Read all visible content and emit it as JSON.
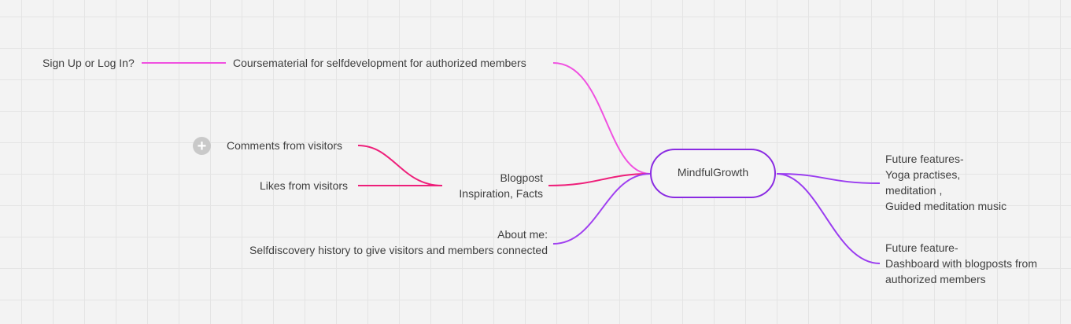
{
  "mindmap": {
    "central": "MindfulGrowth",
    "left_nodes": {
      "coursematerial": "Coursematerial for selfdevelopment for authorized members",
      "signup": "Sign Up or Log In?",
      "blogpost": [
        "Blogpost",
        "Inspiration, Facts"
      ],
      "comments": "Comments from visitors",
      "likes": "Likes from visitors",
      "about": [
        "About me:",
        "Selfdiscovery history to give visitors and members connected"
      ]
    },
    "right_nodes": {
      "future1": [
        "Future features-",
        "Yoga practises,",
        "meditation ,",
        "Guided meditation music"
      ],
      "future2": [
        "Future feature-",
        "Dashboard with blogposts from",
        "authorized members"
      ]
    }
  },
  "controls": {
    "add_icon": "plus-icon",
    "add_symbol": "+"
  },
  "colors": {
    "central_border": "#8a2be2",
    "branch_magenta": "#f050e0",
    "branch_pink": "#ee1f7a",
    "branch_purple": "#a040f0",
    "branch_violet": "#9a3cf0"
  }
}
